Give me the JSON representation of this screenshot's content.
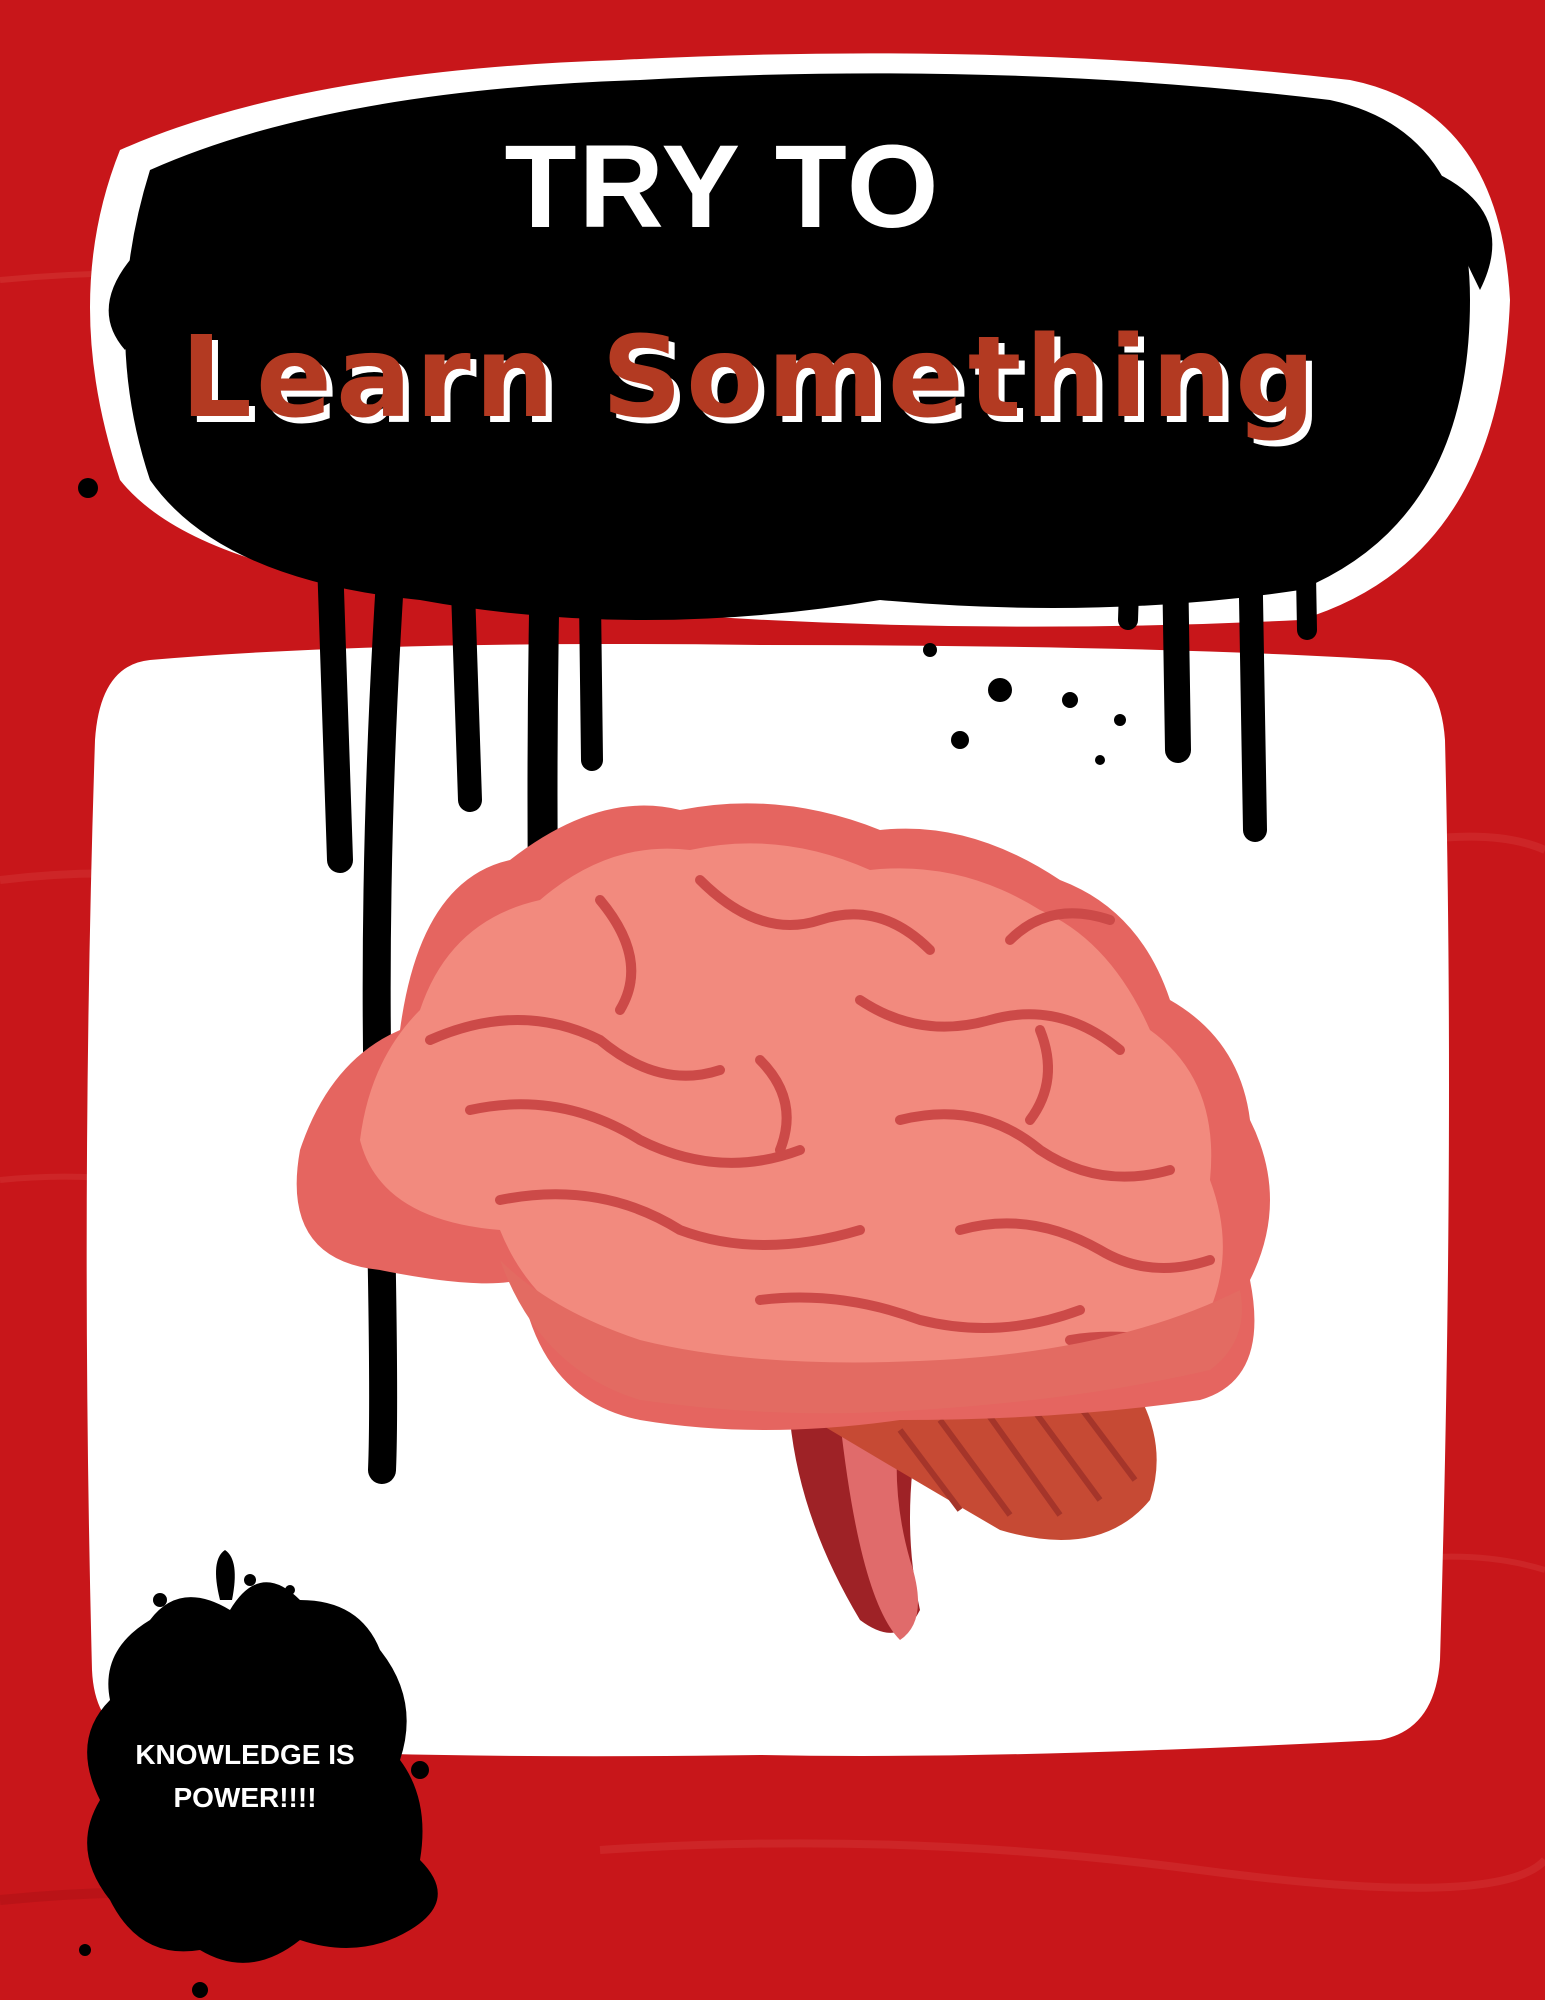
{
  "poster": {
    "title_line_1": "TRY TO",
    "title_line_2": "Learn Something",
    "tagline": "KNOWLEDGE IS\nPOWER!!!!"
  },
  "colors": {
    "background": "#c8161a",
    "panel": "#ffffff",
    "splatter": "#000000",
    "title_accent": "#b33a22",
    "brain": "#ea8478"
  },
  "icons": [
    "brain-illustration",
    "ink-splatter-banner",
    "ink-splatter-badge",
    "paint-drips"
  ]
}
